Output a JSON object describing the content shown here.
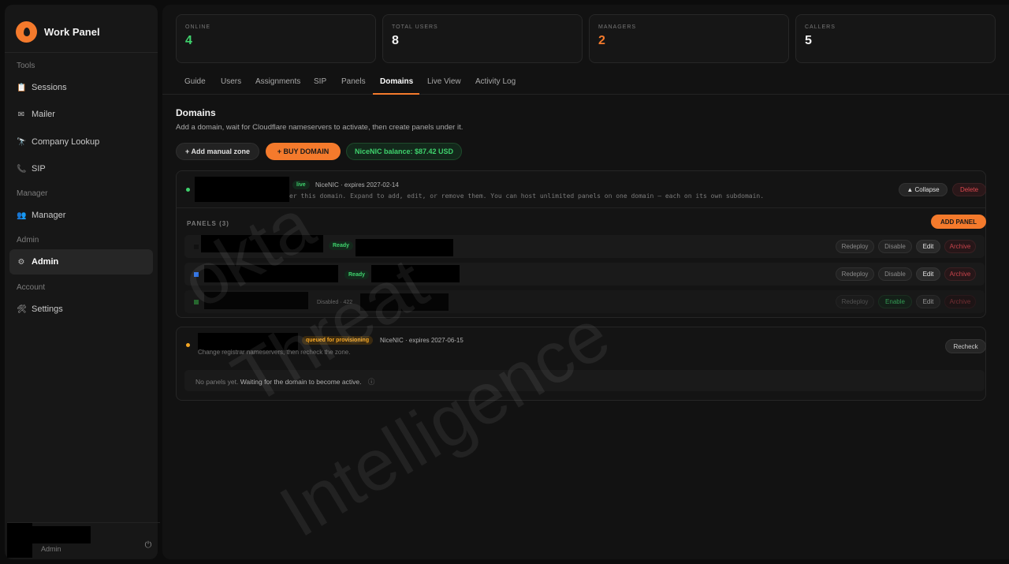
{
  "sidebar": {
    "brand": "Work Panel",
    "sections": {
      "tools": "Tools",
      "manager": "Manager",
      "admin": "Admin",
      "account": "Account"
    },
    "items": {
      "sessions": "Sessions",
      "mailer": "Mailer",
      "company_lookup": "Company Lookup",
      "sip": "SIP",
      "manager": "Manager",
      "admin": "Admin",
      "settings": "Settings"
    },
    "user_role": "Admin"
  },
  "stats": [
    {
      "label": "ONLINE",
      "value": "4",
      "color": "#3fd26d"
    },
    {
      "label": "TOTAL USERS",
      "value": "8",
      "color": "#f2f2f2"
    },
    {
      "label": "MANAGERS",
      "value": "2",
      "color": "#f47a2c"
    },
    {
      "label": "CALLERS",
      "value": "5",
      "color": "#f2f2f2"
    }
  ],
  "tabs": [
    "Guide",
    "Users",
    "Assignments",
    "SIP",
    "Panels",
    "Domains",
    "Live View",
    "Activity Log"
  ],
  "active_tab": "Domains",
  "domains_section": {
    "title": "Domains",
    "description": "Add a domain, wait for Cloudflare nameservers to activate, then create panels under it.",
    "add_manual_zone": "+ Add manual zone",
    "buy_domain": "+ BUY DOMAIN",
    "balance": "NiceNIC balance: $87.42 USD"
  },
  "domain_1": {
    "status_badge": "live",
    "meta": "NiceNIC · expires 2027-02-14",
    "hint": "er this domain. Expand to add, edit, or remove them. You can host unlimited panels on one domain — each on its own subdomain.",
    "collapse": "▲ Collapse",
    "delete": "Delete",
    "panels_label": "PANELS (3)",
    "add_panel": "ADD PANEL",
    "panels": [
      {
        "status": "Ready",
        "redeploy": "Redeploy",
        "toggle": "Disable",
        "edit": "Edit",
        "archive": "Archive"
      },
      {
        "status": "Ready",
        "redeploy": "Redeploy",
        "toggle": "Disable",
        "edit": "Edit",
        "archive": "Archive"
      },
      {
        "status": "Disabled · 422",
        "redeploy": "Redeploy",
        "toggle": "Enable",
        "edit": "Edit",
        "archive": "Archive"
      }
    ]
  },
  "domain_2": {
    "status_badge": "queued for provisioning",
    "meta": "NiceNIC · expires 2027-06-15",
    "hint": "Change registrar nameservers, then recheck the zone.",
    "recheck": "Recheck",
    "empty_prefix": "No panels yet.",
    "empty_text": "Waiting for the domain to become active.",
    "info_icon": "ⓘ"
  },
  "watermark": {
    "line1": "okta",
    "line2": "Threat",
    "line3": "Intelligence"
  },
  "colors": {
    "accent": "#f47a2c",
    "success": "#3fd26d",
    "danger": "#e0484f",
    "warning": "#f5a623"
  }
}
